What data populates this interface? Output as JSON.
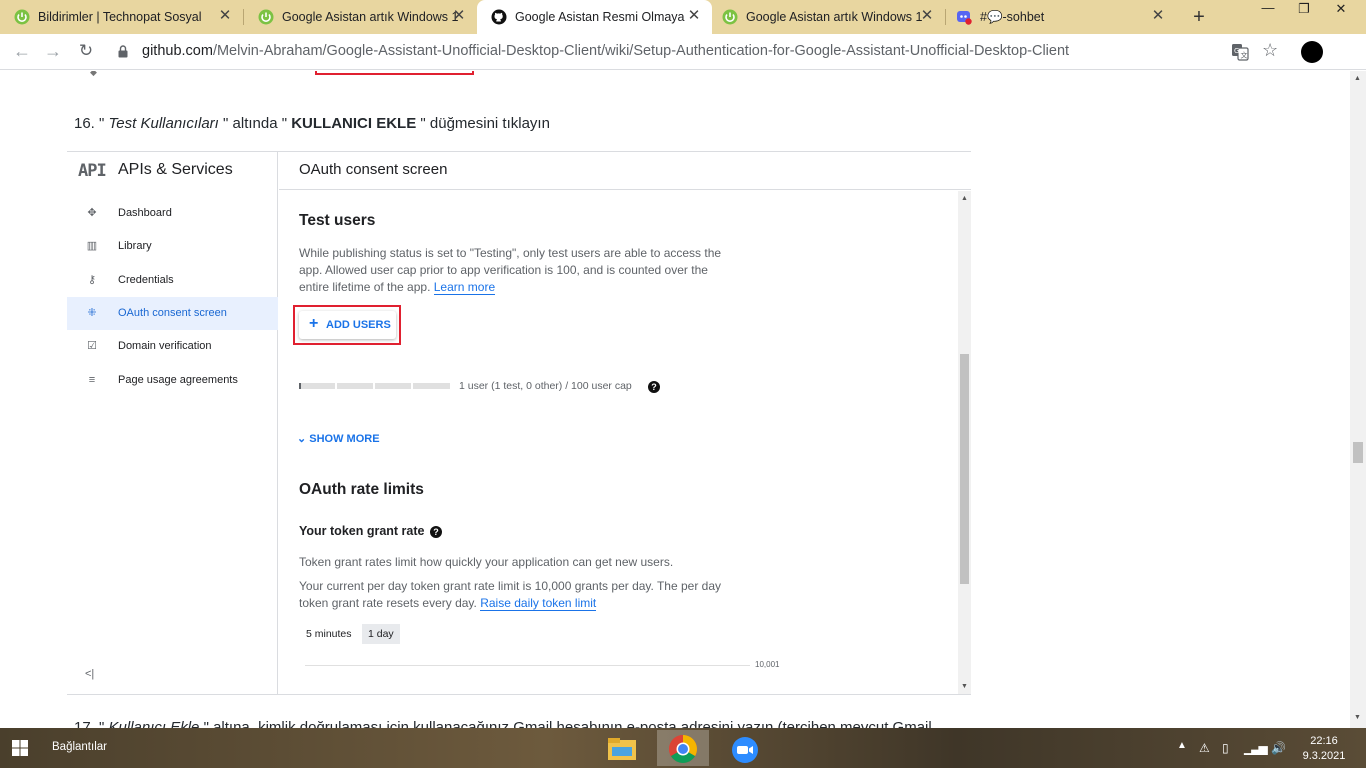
{
  "browser": {
    "tabs": [
      {
        "title": "Bildirimler | Technopat Sosyal",
        "icon": "technopat-icon",
        "active": false
      },
      {
        "title": "Google Asistan artık Windows 1",
        "icon": "technopat-icon",
        "active": false
      },
      {
        "title": "Google Asistan Resmi Olmayan",
        "icon": "github-icon",
        "active": true
      },
      {
        "title": "Google Asistan artık Windows 1",
        "icon": "technopat-icon",
        "active": false
      },
      {
        "title": "#💬-sohbet",
        "icon": "discord-icon",
        "active": false
      }
    ],
    "new_tab_symbol": "+",
    "url_host": "github.com",
    "url_path": "/Melvin-Abraham/Google-Assistant-Unofficial-Desktop-Client/wiki/Setup-Authentication-for-Google-Assistant-Unofficial-Desktop-Client",
    "tab_bar_color": "#e8d6a0"
  },
  "wiki": {
    "step16_prefix": "16. \" ",
    "step16_italic": "Test Kullanıcıları",
    "step16_mid": " \" altında \" ",
    "step16_bold": "KULLANICI EKLE",
    "step16_suffix": " \" düğmesini tıklayın",
    "step17_prefix": "17. \" ",
    "step17_italic": "Kullanıcı Ekle",
    "step17_suffix": " \" altına, kimlik doğrulaması için kullanacağınız Gmail hesabının e-posta adresini yazın (tercihen mevcut Gmail"
  },
  "console": {
    "api_logo": "API",
    "title": "APIs & Services",
    "header": "OAuth consent screen",
    "nav": [
      {
        "label": "Dashboard",
        "icon": "dashboard-icon",
        "glyph": "✥",
        "selected": false
      },
      {
        "label": "Library",
        "icon": "library-icon",
        "glyph": "▥",
        "selected": false
      },
      {
        "label": "Credentials",
        "icon": "key-icon",
        "glyph": "⚷",
        "selected": false
      },
      {
        "label": "OAuth consent screen",
        "icon": "consent-icon",
        "glyph": "⁜",
        "selected": true
      },
      {
        "label": "Domain verification",
        "icon": "domain-check-icon",
        "glyph": "☑",
        "selected": false
      },
      {
        "label": "Page usage agreements",
        "icon": "settings-list-icon",
        "glyph": "≡",
        "selected": false
      }
    ],
    "collapse_symbol": "<|",
    "test_users": {
      "title": "Test users",
      "desc": "While publishing status is set to \"Testing\", only test users are able to access the app. Allowed user cap prior to app verification is 100, and is counted over the entire lifetime of the app. ",
      "learn_more": "Learn more",
      "add_users": "ADD USERS",
      "user_cap_text": "1 user (1 test, 0 other) / 100 user cap",
      "user_cap_fraction": 0.01,
      "show_more": "SHOW MORE"
    },
    "rate_limits": {
      "title": "OAuth rate limits",
      "token_grant_title": "Your token grant rate",
      "p1": "Token grant rates limit how quickly your application can get new users.",
      "p2": "Your current per day token grant rate limit is 10,000 grants per day. The per day token grant rate resets every day. ",
      "raise_link": "Raise daily token limit",
      "toggle_5min": "5 minutes",
      "toggle_1day": "1 day",
      "chart_max_label": "10,001"
    }
  },
  "taskbar": {
    "label": "Bağlantılar",
    "time": "22:16",
    "date": "9.3.2021",
    "apps": [
      {
        "name": "file-explorer-icon",
        "active": false
      },
      {
        "name": "chrome-icon",
        "active": true
      },
      {
        "name": "zoom-icon",
        "active": false
      }
    ]
  }
}
